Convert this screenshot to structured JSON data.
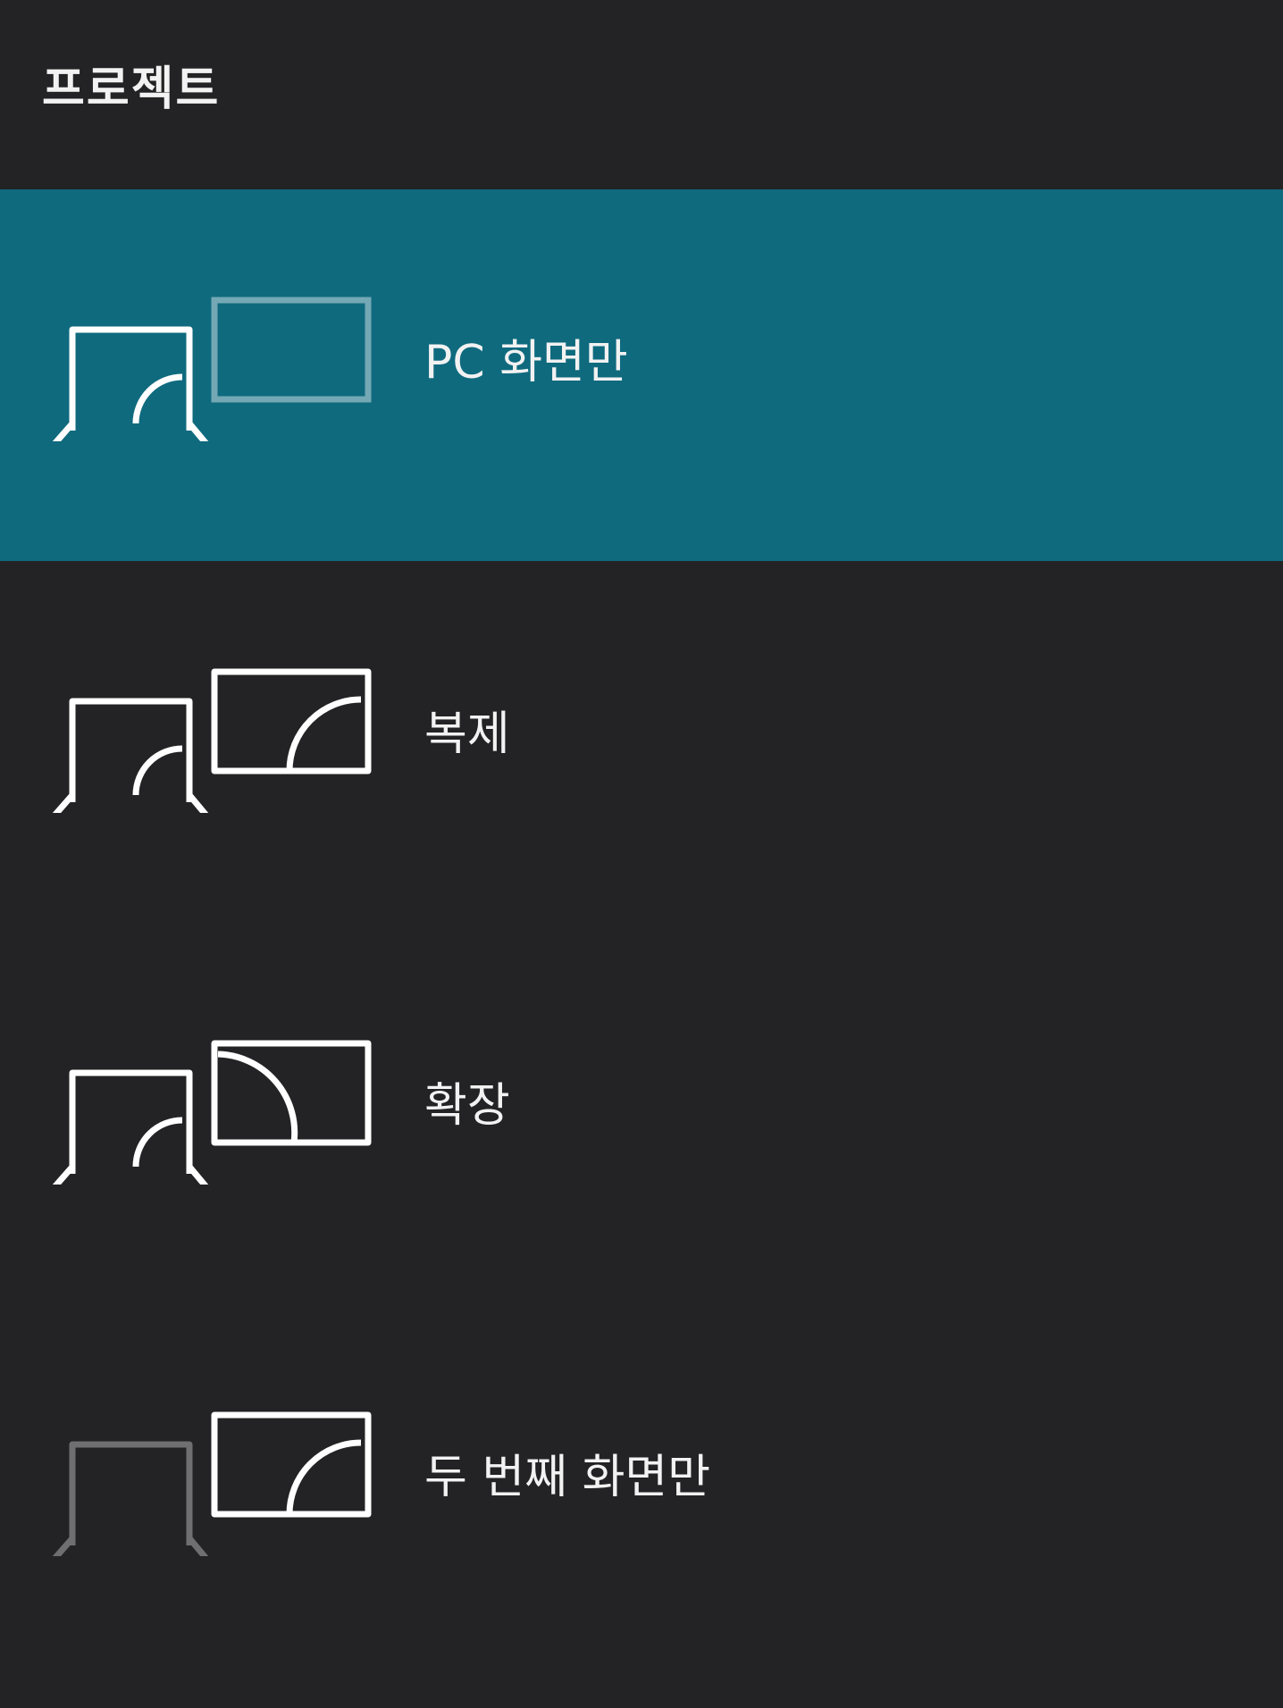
{
  "header": {
    "title": "프로젝트"
  },
  "options": [
    {
      "label": "PC 화면만",
      "icon": "pc-screen-only-icon",
      "selected": true
    },
    {
      "label": "복제",
      "icon": "duplicate-icon",
      "selected": false
    },
    {
      "label": "확장",
      "icon": "extend-icon",
      "selected": false
    },
    {
      "label": "두 번째 화면만",
      "icon": "second-screen-only-icon",
      "selected": false
    }
  ],
  "colors": {
    "background": "#232325",
    "selected_background": "#0f6a7e",
    "foreground": "#f2f2f2",
    "dimmed_icon": "#6f6f71"
  }
}
